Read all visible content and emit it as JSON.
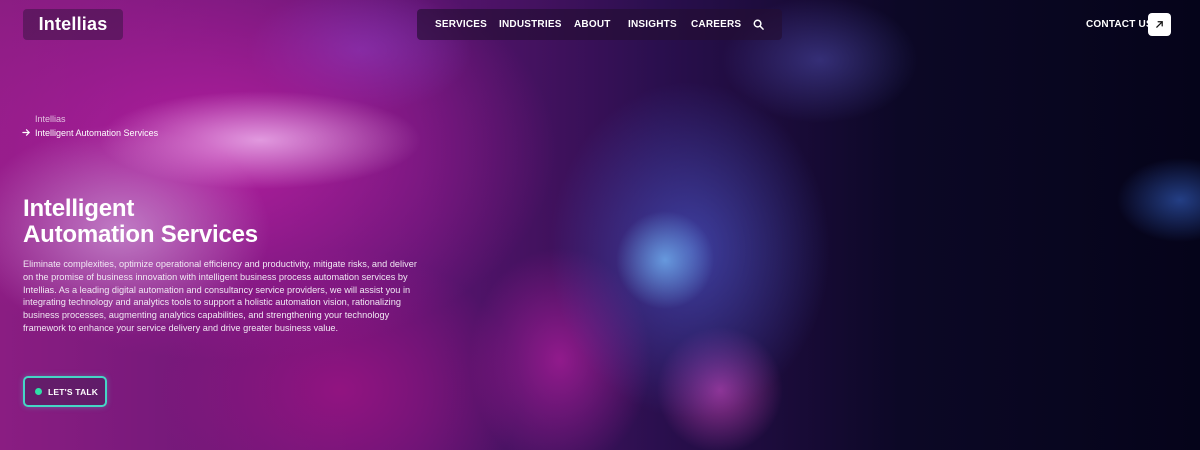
{
  "header": {
    "logo_text": "Intellias",
    "nav": [
      {
        "label": "SERVICES"
      },
      {
        "label": "INDUSTRIES"
      },
      {
        "label": "ABOUT"
      },
      {
        "label": "INSIGHTS"
      },
      {
        "label": "CAREERS"
      }
    ],
    "search_icon": "search-icon",
    "contact_label": "CONTACT US",
    "contact_icon": "arrow-up-right-icon"
  },
  "breadcrumb": {
    "root": "Intellias",
    "current": "Intelligent Automation Services",
    "separator_icon": "arrow-right-icon"
  },
  "hero": {
    "title_line1": "Intelligent",
    "title_line2": "Automation Services",
    "description": "Eliminate complexities, optimize operational efficiency and productivity, mitigate risks, and deliver on the promise of business innovation with intelligent business process automation services by Intellias. As a leading digital automation and consultancy service providers, we will assist you in integrating technology and analytics tools to support a holistic automation vision, rationalizing business processes, augmenting analytics capabilities, and strengthening your technology framework to enhance your service delivery and drive greater business value.",
    "cta_label": "LET'S TALK"
  },
  "colors": {
    "cta_border": "#45d6c6",
    "cta_dot": "#2fe0a8",
    "text": "#ffffff"
  }
}
